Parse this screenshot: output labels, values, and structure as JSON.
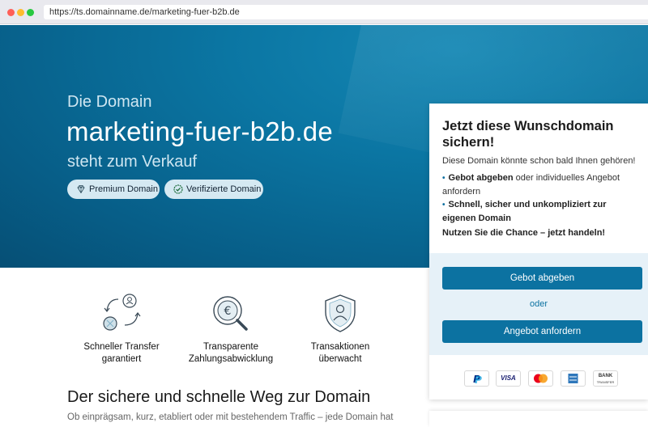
{
  "browser": {
    "url": "https://ts.domainname.de/marketing-fuer-b2b.de"
  },
  "hero": {
    "pretitle": "Die Domain",
    "domain": "marketing-fuer-b2b.de",
    "subtitle": "steht zum Verkauf",
    "badges": [
      {
        "label": "Premium Domain",
        "icon": "diamond-icon"
      },
      {
        "label": "Verifizierte Domain",
        "icon": "verified-check-icon"
      }
    ]
  },
  "features": [
    {
      "label_line1": "Schneller Transfer",
      "label_line2": "garantiert",
      "icon": "transfer-icon"
    },
    {
      "label_line1": "Transparente",
      "label_line2": "Zahlungsabwicklung",
      "icon": "euro-magnifier-icon"
    },
    {
      "label_line1": "Transaktionen",
      "label_line2": "überwacht",
      "icon": "shield-person-icon"
    }
  ],
  "section": {
    "heading": "Der sichere und schnelle Weg zur Domain",
    "paragraph": "Ob einprägsam, kurz, etabliert oder mit bestehendem Traffic – jede Domain hat"
  },
  "card": {
    "title": "Jetzt diese Wunschdomain sichern!",
    "lead": "Diese Domain könnte schon bald Ihnen gehören!",
    "bullet1_strong": "Gebot abgeben",
    "bullet1_rest": " oder individuelles Angebot anfordern",
    "bullet2_strong": "Schnell, sicher und unkompliziert zur eigenen Domain",
    "cta_note": "Nutzen Sie die Chance – jetzt handeln!",
    "button_bid": "Gebot abgeben",
    "or": "oder",
    "button_offer": "Angebot anfordern",
    "payments": [
      "PayPal",
      "VISA",
      "Mastercard",
      "American Express",
      "BANK TRANSFER"
    ],
    "visa_text": "VISA",
    "bank_line1": "BANK",
    "bank_line2": "TRANSFER"
  },
  "colors": {
    "hero_blue": "#0b76a3",
    "accent_button": "#0c72a1",
    "card_blue_bg": "#e6f1f8"
  }
}
